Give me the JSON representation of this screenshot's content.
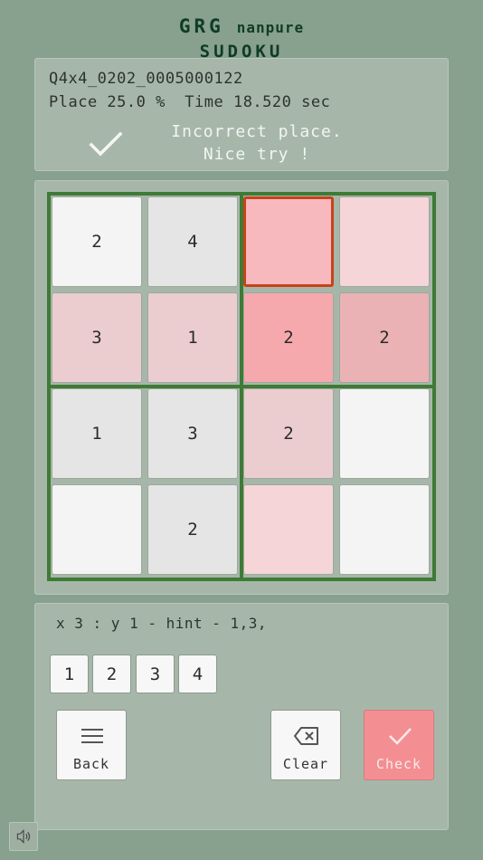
{
  "logo": {
    "line1a": "GRG",
    "line1b": "nanpure",
    "line2": "SUDOKU"
  },
  "status": {
    "puzzle_id": "Q4x4_0202_0005000122",
    "stats": "Place 25.0 %  Time 18.520 sec",
    "message_line1": "Incorrect place.",
    "message_line2": "Nice try !"
  },
  "board": {
    "size": 4,
    "selected": [
      0,
      2
    ],
    "cells": [
      [
        {
          "v": "2",
          "bg": "#f4f4f4"
        },
        {
          "v": "4",
          "bg": "#e5e5e5"
        },
        {
          "v": "",
          "bg": "#f7b9be"
        },
        {
          "v": "",
          "bg": "#f6d5d8"
        }
      ],
      [
        {
          "v": "3",
          "bg": "#ebcdd0"
        },
        {
          "v": "1",
          "bg": "#ebcdd0"
        },
        {
          "v": "2",
          "bg": "#f6a9ad"
        },
        {
          "v": "2",
          "bg": "#ebb2b5"
        }
      ],
      [
        {
          "v": "1",
          "bg": "#e5e5e5"
        },
        {
          "v": "3",
          "bg": "#e5e5e5"
        },
        {
          "v": "2",
          "bg": "#ebcdd0"
        },
        {
          "v": "",
          "bg": "#f4f4f4"
        }
      ],
      [
        {
          "v": "",
          "bg": "#f4f4f4"
        },
        {
          "v": "2",
          "bg": "#e5e5e5"
        },
        {
          "v": "",
          "bg": "#f6d5d8"
        },
        {
          "v": "",
          "bg": "#f4f4f4"
        }
      ]
    ]
  },
  "input": {
    "hint": "x 3 : y 1 - hint - 1,3,",
    "numbers": [
      "1",
      "2",
      "3",
      "4"
    ],
    "back_label": "Back",
    "clear_label": "Clear",
    "check_label": "Check"
  },
  "colors": {
    "background": "#88a08e",
    "frame": "#3f7a36",
    "selected_border": "#c8421a",
    "check_button": "#f38f93"
  },
  "icons": {
    "status": "checkmark-icon",
    "back": "menu-icon",
    "clear": "backspace-icon",
    "check": "checkmark-icon",
    "sound": "speaker-icon"
  }
}
